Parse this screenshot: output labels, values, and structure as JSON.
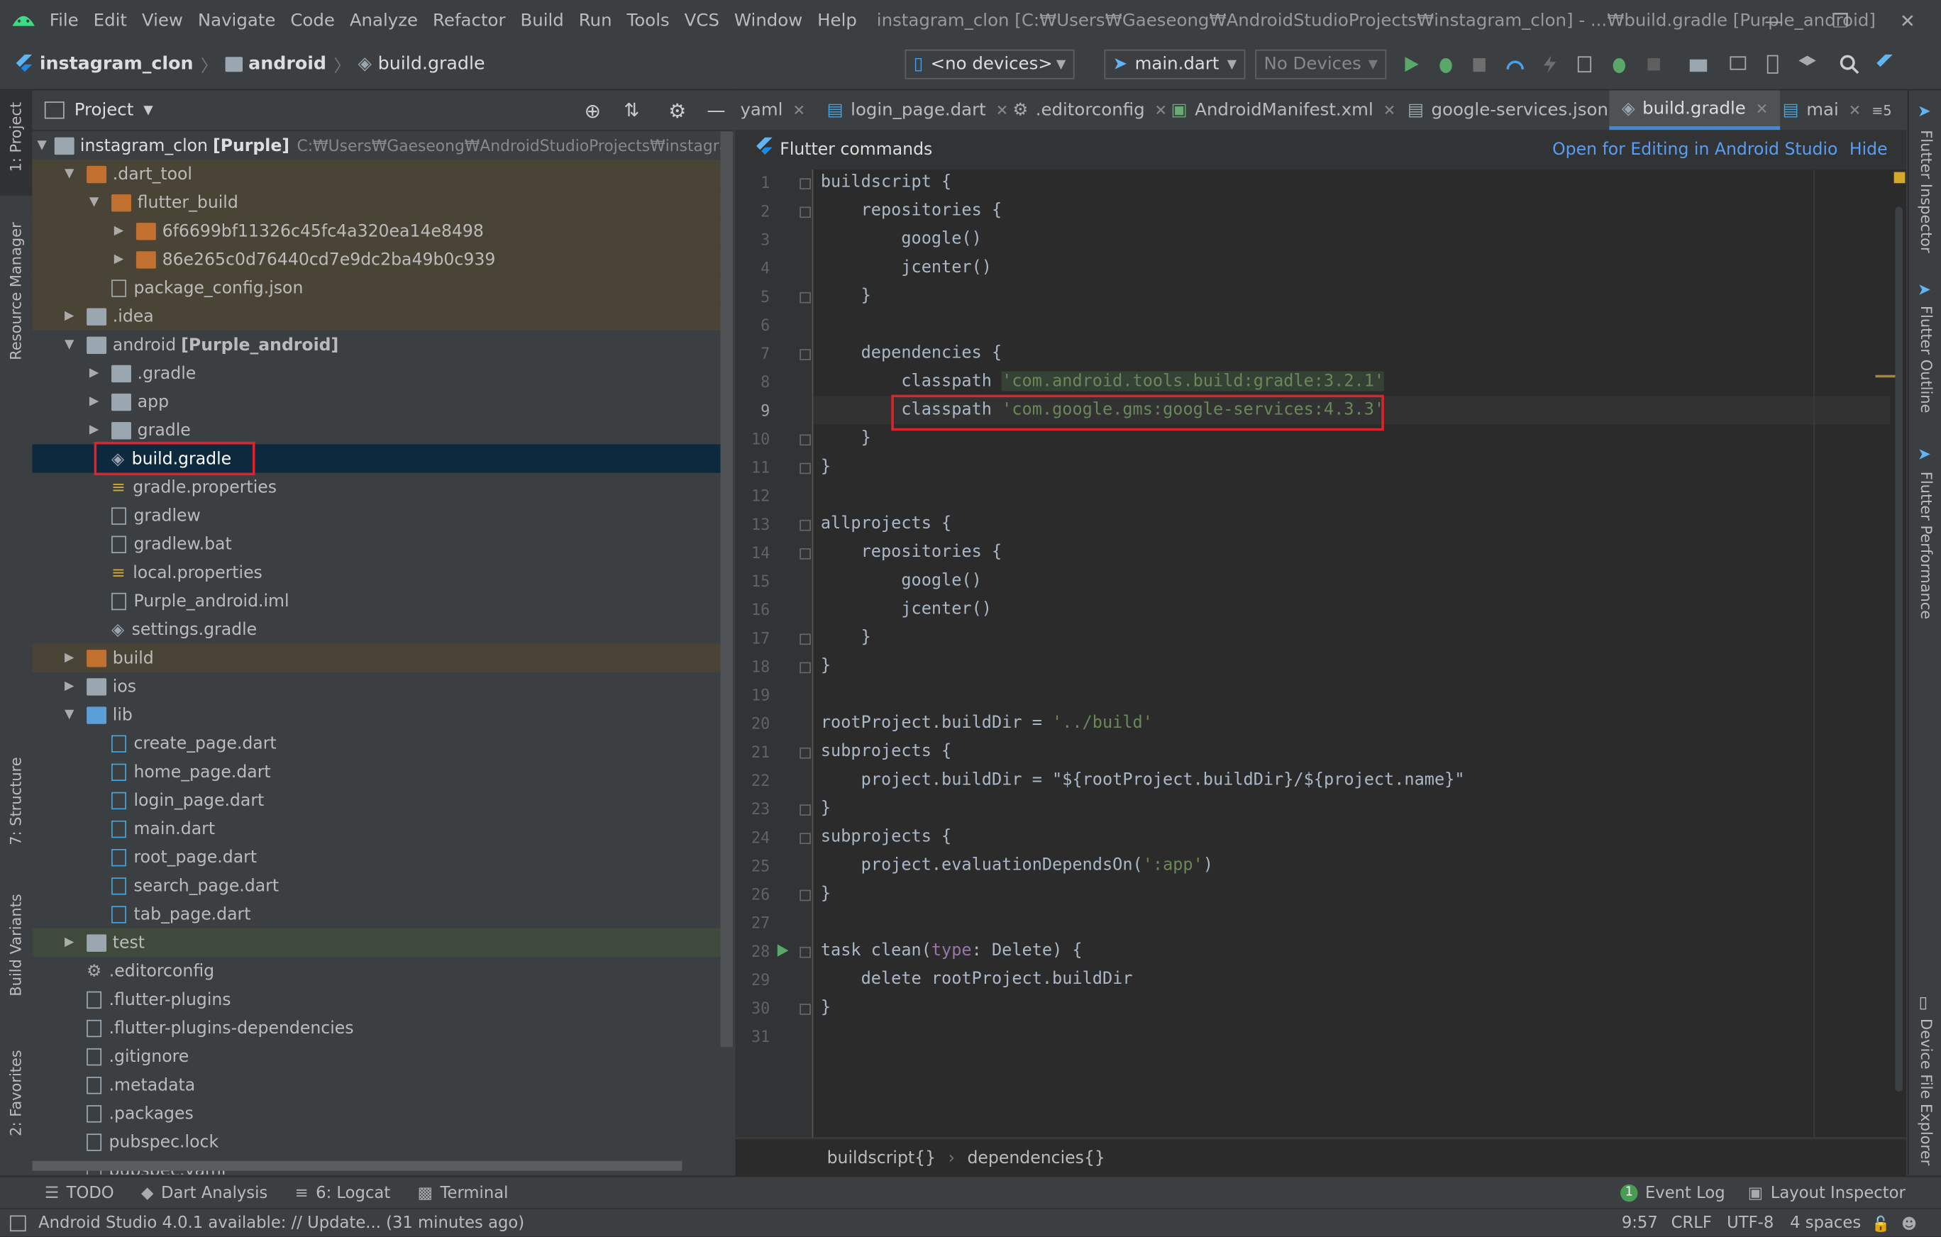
{
  "menu": {
    "items": [
      "File",
      "Edit",
      "View",
      "Navigate",
      "Code",
      "Analyze",
      "Refactor",
      "Build",
      "Run",
      "Tools",
      "VCS",
      "Window",
      "Help"
    ],
    "window_title": "instagram_clon [C:₩Users₩Gaeseong₩AndroidStudioProjects₩instagram_clon] - ...₩build.gradle [Purple_android]"
  },
  "navbar": {
    "crumbs": [
      "instagram_clon",
      "android",
      "build.gradle"
    ],
    "device_combo": "<no devices>",
    "run_config": "main.dart",
    "devices_combo": "No Devices"
  },
  "left_strip": {
    "project": "1: Project",
    "resource_manager": "Resource Manager",
    "structure": "7: Structure",
    "build_variants": "Build Variants",
    "favorites": "2: Favorites"
  },
  "right_strip": {
    "flutter_inspector": "Flutter Inspector",
    "flutter_outline": "Flutter Outline",
    "flutter_performance": "Flutter Performance",
    "device_file_explorer": "Device File Explorer"
  },
  "project_panel": {
    "title": "Project",
    "root_name": "instagram_clon",
    "root_module": "[Purple]",
    "root_path": "C:₩Users₩Gaeseong₩AndroidStudioProjects₩instagram_clo",
    "tree": [
      {
        "label": ".dart_tool",
        "depth": 1,
        "arrow": "open",
        "icon": "folder-orange",
        "tint": "excluded"
      },
      {
        "label": "flutter_build",
        "depth": 2,
        "arrow": "open",
        "icon": "folder-orange",
        "tint": "excluded"
      },
      {
        "label": "6f6699bf11326c45fc4a320ea14e8498",
        "depth": 3,
        "arrow": "closed",
        "icon": "folder-orange",
        "tint": "excluded"
      },
      {
        "label": "86e265c0d76440cd7e9dc2ba49b0c939",
        "depth": 3,
        "arrow": "closed",
        "icon": "folder-orange",
        "tint": "excluded"
      },
      {
        "label": "package_config.json",
        "depth": 2,
        "arrow": "none",
        "icon": "file",
        "tint": "excluded"
      },
      {
        "label": ".idea",
        "depth": 1,
        "arrow": "closed",
        "icon": "folder-gray",
        "tint": "excluded"
      },
      {
        "label": "android",
        "extra": "[Purple_android]",
        "depth": 1,
        "arrow": "open",
        "icon": "folder-gray",
        "tint": "none"
      },
      {
        "label": ".gradle",
        "depth": 2,
        "arrow": "closed",
        "icon": "folder-gray",
        "tint": "none"
      },
      {
        "label": "app",
        "depth": 2,
        "arrow": "closed",
        "icon": "folder-gray",
        "tint": "none"
      },
      {
        "label": "gradle",
        "depth": 2,
        "arrow": "closed",
        "icon": "folder-gray",
        "tint": "none"
      },
      {
        "label": "build.gradle",
        "depth": 2,
        "arrow": "none",
        "icon": "gradle",
        "tint": "selected"
      },
      {
        "label": "gradle.properties",
        "depth": 2,
        "arrow": "none",
        "icon": "props",
        "tint": "none"
      },
      {
        "label": "gradlew",
        "depth": 2,
        "arrow": "none",
        "icon": "file",
        "tint": "none"
      },
      {
        "label": "gradlew.bat",
        "depth": 2,
        "arrow": "none",
        "icon": "file",
        "tint": "none"
      },
      {
        "label": "local.properties",
        "depth": 2,
        "arrow": "none",
        "icon": "props",
        "tint": "none"
      },
      {
        "label": "Purple_android.iml",
        "depth": 2,
        "arrow": "none",
        "icon": "file",
        "tint": "none"
      },
      {
        "label": "settings.gradle",
        "depth": 2,
        "arrow": "none",
        "icon": "gradle",
        "tint": "none"
      },
      {
        "label": "build",
        "depth": 1,
        "arrow": "closed",
        "icon": "folder-orange",
        "tint": "excluded"
      },
      {
        "label": "ios",
        "depth": 1,
        "arrow": "closed",
        "icon": "folder-gray",
        "tint": "none"
      },
      {
        "label": "lib",
        "depth": 1,
        "arrow": "open",
        "icon": "folder-blue",
        "tint": "none"
      },
      {
        "label": "create_page.dart",
        "depth": 2,
        "arrow": "none",
        "icon": "dart",
        "tint": "none"
      },
      {
        "label": "home_page.dart",
        "depth": 2,
        "arrow": "none",
        "icon": "dart",
        "tint": "none"
      },
      {
        "label": "login_page.dart",
        "depth": 2,
        "arrow": "none",
        "icon": "dart",
        "tint": "none"
      },
      {
        "label": "main.dart",
        "depth": 2,
        "arrow": "none",
        "icon": "dart",
        "tint": "none"
      },
      {
        "label": "root_page.dart",
        "depth": 2,
        "arrow": "none",
        "icon": "dart",
        "tint": "none"
      },
      {
        "label": "search_page.dart",
        "depth": 2,
        "arrow": "none",
        "icon": "dart",
        "tint": "none"
      },
      {
        "label": "tab_page.dart",
        "depth": 2,
        "arrow": "none",
        "icon": "dart",
        "tint": "none"
      },
      {
        "label": "test",
        "depth": 1,
        "arrow": "closed",
        "icon": "folder-green",
        "tint": "test"
      },
      {
        "label": ".editorconfig",
        "depth": 1,
        "arrow": "none",
        "icon": "gear",
        "tint": "none"
      },
      {
        "label": ".flutter-plugins",
        "depth": 1,
        "arrow": "none",
        "icon": "file",
        "tint": "none"
      },
      {
        "label": ".flutter-plugins-dependencies",
        "depth": 1,
        "arrow": "none",
        "icon": "file",
        "tint": "none"
      },
      {
        "label": ".gitignore",
        "depth": 1,
        "arrow": "none",
        "icon": "file",
        "tint": "none"
      },
      {
        "label": ".metadata",
        "depth": 1,
        "arrow": "none",
        "icon": "file",
        "tint": "none"
      },
      {
        "label": ".packages",
        "depth": 1,
        "arrow": "none",
        "icon": "file",
        "tint": "none"
      },
      {
        "label": "pubspec.lock",
        "depth": 1,
        "arrow": "none",
        "icon": "file",
        "tint": "none"
      },
      {
        "label": "pubspec.yaml",
        "depth": 1,
        "arrow": "none",
        "icon": "file",
        "tint": "none"
      }
    ]
  },
  "editor": {
    "tabs": [
      {
        "label": "yaml",
        "icon": "file",
        "active": false
      },
      {
        "label": "login_page.dart",
        "icon": "dart",
        "active": false
      },
      {
        "label": ".editorconfig",
        "icon": "gear",
        "active": false
      },
      {
        "label": "AndroidManifest.xml",
        "icon": "manifest",
        "active": false
      },
      {
        "label": "google-services.json",
        "icon": "file",
        "active": false
      },
      {
        "label": "build.gradle",
        "icon": "gradle",
        "active": true
      },
      {
        "label": "mai",
        "icon": "dart",
        "active": false
      }
    ],
    "tab_overflow": "≡5",
    "flutter_bar": {
      "title": "Flutter commands",
      "open_link": "Open for Editing in Android Studio",
      "hide_link": "Hide"
    },
    "current_line": 9,
    "lines": [
      [
        {
          "t": "buildscript {",
          "c": "p"
        }
      ],
      [
        {
          "t": "    repositories {",
          "c": "p"
        }
      ],
      [
        {
          "t": "        google()",
          "c": "p"
        }
      ],
      [
        {
          "t": "        jcenter()",
          "c": "p"
        }
      ],
      [
        {
          "t": "    }",
          "c": "p"
        }
      ],
      [],
      [
        {
          "t": "    dependencies {",
          "c": "p"
        }
      ],
      [
        {
          "t": "        classpath ",
          "c": "p"
        },
        {
          "t": "'com.android.tools.build:gradle:3.2.1'",
          "c": "sh"
        }
      ],
      [
        {
          "t": "        classpath ",
          "c": "p"
        },
        {
          "t": "'com.google.gms:google-services:4.3.3'",
          "c": "s"
        }
      ],
      [
        {
          "t": "    }",
          "c": "p"
        }
      ],
      [
        {
          "t": "}",
          "c": "p"
        }
      ],
      [],
      [
        {
          "t": "allprojects {",
          "c": "p"
        }
      ],
      [
        {
          "t": "    repositories {",
          "c": "p"
        }
      ],
      [
        {
          "t": "        google()",
          "c": "p"
        }
      ],
      [
        {
          "t": "        jcenter()",
          "c": "p"
        }
      ],
      [
        {
          "t": "    }",
          "c": "p"
        }
      ],
      [
        {
          "t": "}",
          "c": "p"
        }
      ],
      [],
      [
        {
          "t": "rootProject.buildDir = ",
          "c": "p"
        },
        {
          "t": "'../build'",
          "c": "s"
        }
      ],
      [
        {
          "t": "subprojects {",
          "c": "p"
        }
      ],
      [
        {
          "t": "    project.buildDir = ",
          "c": "p"
        },
        {
          "t": "\"${rootProject.buildDir}/${project.name}\"",
          "c": "p"
        }
      ],
      [
        {
          "t": "}",
          "c": "p"
        }
      ],
      [
        {
          "t": "subprojects {",
          "c": "p"
        }
      ],
      [
        {
          "t": "    project.evaluationDependsOn(",
          "c": "p"
        },
        {
          "t": "':app'",
          "c": "s"
        },
        {
          "t": ")",
          "c": "p"
        }
      ],
      [
        {
          "t": "}",
          "c": "p"
        }
      ],
      [],
      [
        {
          "t": "task clean(",
          "c": "p"
        },
        {
          "t": "type",
          "c": "k"
        },
        {
          "t": ": Delete) {",
          "c": "p"
        }
      ],
      [
        {
          "t": "    delete rootProject.buildDir",
          "c": "p"
        }
      ],
      [
        {
          "t": "}",
          "c": "p"
        }
      ],
      []
    ],
    "breadcrumbs": [
      "buildscript{}",
      "dependencies{}"
    ]
  },
  "bottom_tools": {
    "todo": "TODO",
    "dart_analysis": "Dart Analysis",
    "logcat": "6: Logcat",
    "terminal": "Terminal",
    "event_log_count": "1",
    "event_log": "Event Log",
    "layout_inspector": "Layout Inspector"
  },
  "status": {
    "message": "Android Studio 4.0.1 available: // Update... (31 minutes ago)",
    "position": "9:57",
    "line_sep": "CRLF",
    "encoding": "UTF-8",
    "indent": "4 spaces"
  },
  "colors": {
    "selection": "#0d293e",
    "highlight_box": "#e0232a",
    "string": "#6a8759",
    "accent": "#4a88c7"
  }
}
